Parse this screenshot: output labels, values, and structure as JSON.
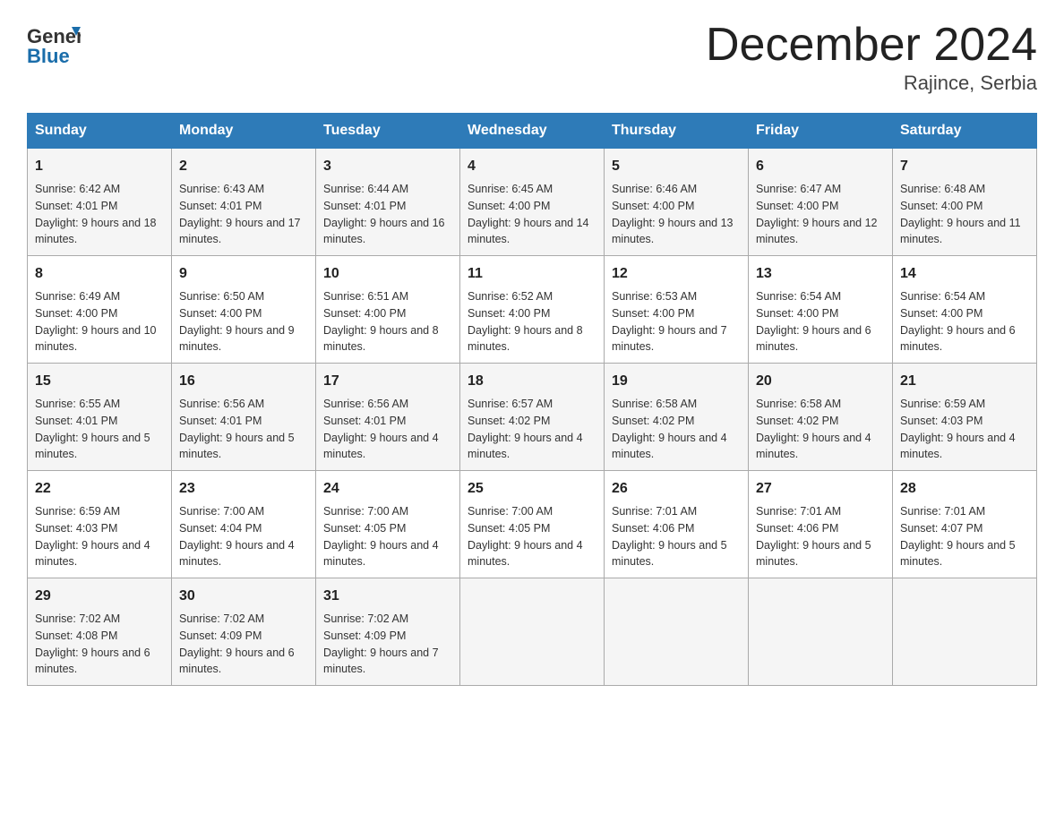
{
  "header": {
    "logo_general": "General",
    "logo_blue": "Blue",
    "title": "December 2024",
    "subtitle": "Rajince, Serbia"
  },
  "days_of_week": [
    "Sunday",
    "Monday",
    "Tuesday",
    "Wednesday",
    "Thursday",
    "Friday",
    "Saturday"
  ],
  "weeks": [
    [
      {
        "num": "1",
        "sunrise": "6:42 AM",
        "sunset": "4:01 PM",
        "daylight": "9 hours and 18 minutes."
      },
      {
        "num": "2",
        "sunrise": "6:43 AM",
        "sunset": "4:01 PM",
        "daylight": "9 hours and 17 minutes."
      },
      {
        "num": "3",
        "sunrise": "6:44 AM",
        "sunset": "4:01 PM",
        "daylight": "9 hours and 16 minutes."
      },
      {
        "num": "4",
        "sunrise": "6:45 AM",
        "sunset": "4:00 PM",
        "daylight": "9 hours and 14 minutes."
      },
      {
        "num": "5",
        "sunrise": "6:46 AM",
        "sunset": "4:00 PM",
        "daylight": "9 hours and 13 minutes."
      },
      {
        "num": "6",
        "sunrise": "6:47 AM",
        "sunset": "4:00 PM",
        "daylight": "9 hours and 12 minutes."
      },
      {
        "num": "7",
        "sunrise": "6:48 AM",
        "sunset": "4:00 PM",
        "daylight": "9 hours and 11 minutes."
      }
    ],
    [
      {
        "num": "8",
        "sunrise": "6:49 AM",
        "sunset": "4:00 PM",
        "daylight": "9 hours and 10 minutes."
      },
      {
        "num": "9",
        "sunrise": "6:50 AM",
        "sunset": "4:00 PM",
        "daylight": "9 hours and 9 minutes."
      },
      {
        "num": "10",
        "sunrise": "6:51 AM",
        "sunset": "4:00 PM",
        "daylight": "9 hours and 8 minutes."
      },
      {
        "num": "11",
        "sunrise": "6:52 AM",
        "sunset": "4:00 PM",
        "daylight": "9 hours and 8 minutes."
      },
      {
        "num": "12",
        "sunrise": "6:53 AM",
        "sunset": "4:00 PM",
        "daylight": "9 hours and 7 minutes."
      },
      {
        "num": "13",
        "sunrise": "6:54 AM",
        "sunset": "4:00 PM",
        "daylight": "9 hours and 6 minutes."
      },
      {
        "num": "14",
        "sunrise": "6:54 AM",
        "sunset": "4:00 PM",
        "daylight": "9 hours and 6 minutes."
      }
    ],
    [
      {
        "num": "15",
        "sunrise": "6:55 AM",
        "sunset": "4:01 PM",
        "daylight": "9 hours and 5 minutes."
      },
      {
        "num": "16",
        "sunrise": "6:56 AM",
        "sunset": "4:01 PM",
        "daylight": "9 hours and 5 minutes."
      },
      {
        "num": "17",
        "sunrise": "6:56 AM",
        "sunset": "4:01 PM",
        "daylight": "9 hours and 4 minutes."
      },
      {
        "num": "18",
        "sunrise": "6:57 AM",
        "sunset": "4:02 PM",
        "daylight": "9 hours and 4 minutes."
      },
      {
        "num": "19",
        "sunrise": "6:58 AM",
        "sunset": "4:02 PM",
        "daylight": "9 hours and 4 minutes."
      },
      {
        "num": "20",
        "sunrise": "6:58 AM",
        "sunset": "4:02 PM",
        "daylight": "9 hours and 4 minutes."
      },
      {
        "num": "21",
        "sunrise": "6:59 AM",
        "sunset": "4:03 PM",
        "daylight": "9 hours and 4 minutes."
      }
    ],
    [
      {
        "num": "22",
        "sunrise": "6:59 AM",
        "sunset": "4:03 PM",
        "daylight": "9 hours and 4 minutes."
      },
      {
        "num": "23",
        "sunrise": "7:00 AM",
        "sunset": "4:04 PM",
        "daylight": "9 hours and 4 minutes."
      },
      {
        "num": "24",
        "sunrise": "7:00 AM",
        "sunset": "4:05 PM",
        "daylight": "9 hours and 4 minutes."
      },
      {
        "num": "25",
        "sunrise": "7:00 AM",
        "sunset": "4:05 PM",
        "daylight": "9 hours and 4 minutes."
      },
      {
        "num": "26",
        "sunrise": "7:01 AM",
        "sunset": "4:06 PM",
        "daylight": "9 hours and 5 minutes."
      },
      {
        "num": "27",
        "sunrise": "7:01 AM",
        "sunset": "4:06 PM",
        "daylight": "9 hours and 5 minutes."
      },
      {
        "num": "28",
        "sunrise": "7:01 AM",
        "sunset": "4:07 PM",
        "daylight": "9 hours and 5 minutes."
      }
    ],
    [
      {
        "num": "29",
        "sunrise": "7:02 AM",
        "sunset": "4:08 PM",
        "daylight": "9 hours and 6 minutes."
      },
      {
        "num": "30",
        "sunrise": "7:02 AM",
        "sunset": "4:09 PM",
        "daylight": "9 hours and 6 minutes."
      },
      {
        "num": "31",
        "sunrise": "7:02 AM",
        "sunset": "4:09 PM",
        "daylight": "9 hours and 7 minutes."
      },
      {
        "num": "",
        "sunrise": "",
        "sunset": "",
        "daylight": ""
      },
      {
        "num": "",
        "sunrise": "",
        "sunset": "",
        "daylight": ""
      },
      {
        "num": "",
        "sunrise": "",
        "sunset": "",
        "daylight": ""
      },
      {
        "num": "",
        "sunrise": "",
        "sunset": "",
        "daylight": ""
      }
    ]
  ]
}
